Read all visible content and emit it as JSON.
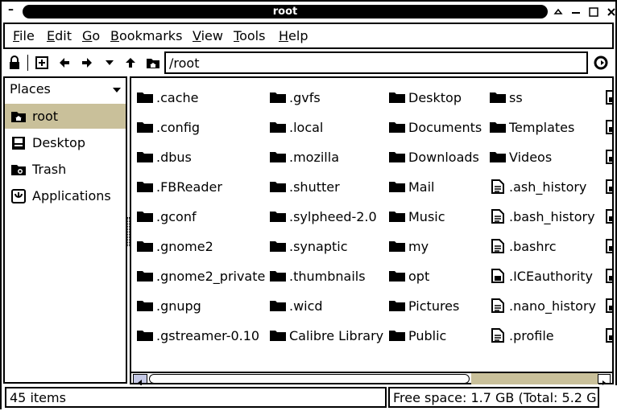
{
  "window": {
    "title": "root",
    "minimize_glyph": "–"
  },
  "menubar": {
    "items": [
      {
        "accel": "F",
        "rest": "ile"
      },
      {
        "accel": "E",
        "rest": "dit"
      },
      {
        "accel": "G",
        "rest": "o"
      },
      {
        "accel": "B",
        "rest": "ookmarks"
      },
      {
        "accel": "V",
        "rest": "iew"
      },
      {
        "accel": "T",
        "rest": "ools"
      },
      {
        "accel": "H",
        "rest": "elp"
      }
    ]
  },
  "toolbar": {
    "path_value": "/root",
    "icons": [
      "lock-icon",
      "new-tab-icon",
      "back-icon",
      "forward-icon",
      "history-dropdown-icon",
      "up-icon",
      "home-folder-icon",
      "go-icon"
    ]
  },
  "sidebar": {
    "header": "Places",
    "items": [
      {
        "label": "root",
        "icon": "home-folder-icon",
        "selected": true
      },
      {
        "label": "Desktop",
        "icon": "desktop-icon",
        "selected": false
      },
      {
        "label": "Trash",
        "icon": "trash-icon",
        "selected": false
      },
      {
        "label": "Applications",
        "icon": "applications-icon",
        "selected": false
      }
    ]
  },
  "files": {
    "columns": [
      [
        {
          "name": ".cache",
          "type": "folder"
        },
        {
          "name": ".config",
          "type": "folder"
        },
        {
          "name": ".dbus",
          "type": "folder"
        },
        {
          "name": ".FBReader",
          "type": "folder"
        },
        {
          "name": ".gconf",
          "type": "folder"
        },
        {
          "name": ".gnome2",
          "type": "folder"
        },
        {
          "name": ".gnome2_private",
          "type": "folder"
        },
        {
          "name": ".gnupg",
          "type": "folder"
        },
        {
          "name": ".gstreamer-0.10",
          "type": "folder"
        }
      ],
      [
        {
          "name": ".gvfs",
          "type": "folder"
        },
        {
          "name": ".local",
          "type": "folder"
        },
        {
          "name": ".mozilla",
          "type": "folder"
        },
        {
          "name": ".shutter",
          "type": "folder"
        },
        {
          "name": ".sylpheed-2.0",
          "type": "folder"
        },
        {
          "name": ".synaptic",
          "type": "folder"
        },
        {
          "name": ".thumbnails",
          "type": "folder"
        },
        {
          "name": ".wicd",
          "type": "folder"
        },
        {
          "name": "Calibre Library",
          "type": "folder"
        }
      ],
      [
        {
          "name": "Desktop",
          "type": "folder"
        },
        {
          "name": "Documents",
          "type": "folder"
        },
        {
          "name": "Downloads",
          "type": "folder"
        },
        {
          "name": "Mail",
          "type": "folder"
        },
        {
          "name": "Music",
          "type": "folder"
        },
        {
          "name": "my",
          "type": "folder"
        },
        {
          "name": "opt",
          "type": "folder"
        },
        {
          "name": "Pictures",
          "type": "folder"
        },
        {
          "name": "Public",
          "type": "folder"
        }
      ],
      [
        {
          "name": "ss",
          "type": "folder"
        },
        {
          "name": "Templates",
          "type": "folder"
        },
        {
          "name": "Videos",
          "type": "folder"
        },
        {
          "name": ".ash_history",
          "type": "text"
        },
        {
          "name": ".bash_history",
          "type": "text"
        },
        {
          "name": ".bashrc",
          "type": "text"
        },
        {
          "name": ".ICEauthority",
          "type": "binary"
        },
        {
          "name": ".nano_history",
          "type": "text"
        },
        {
          "name": ".profile",
          "type": "text"
        }
      ]
    ]
  },
  "status": {
    "items_count": "45 items",
    "free_space": "Free space: 1.7 GB (Total: 5.2 GB)"
  },
  "colors": {
    "selection": "#c9c09a",
    "scroll_arrow": "#c5c9e6"
  }
}
